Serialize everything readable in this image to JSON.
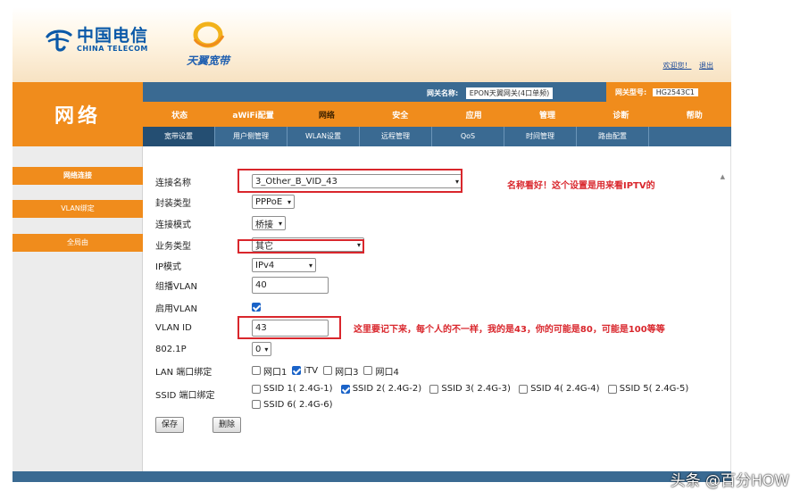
{
  "header": {
    "brand_cn": "中国电信",
    "brand_en": "CHINA TELECOM",
    "sub_brand": "天翼宽带",
    "links": [
      "欢迎您！",
      "退出"
    ]
  },
  "section_title": "网络",
  "info_bar": {
    "gateway_name_label": "网关名称:",
    "gateway_name_value": "EPON天翼网关(4口单频)",
    "gateway_model_label": "网关型号:",
    "gateway_model_value": "HG2543C1"
  },
  "main_nav": [
    "状态",
    "aWiFi配置",
    "网络",
    "安全",
    "应用",
    "管理",
    "诊断",
    "帮助"
  ],
  "sub_nav": [
    "宽带设置",
    "用户侧管理",
    "WLAN设置",
    "远程管理",
    "QoS",
    "时间管理",
    "路由配置"
  ],
  "sidebar": [
    "网络连接",
    "VLAN绑定",
    "全局由"
  ],
  "form": {
    "connection_name": {
      "label": "连接名称",
      "value": "3_Other_B_VID_43"
    },
    "encap_type": {
      "label": "封装类型",
      "value": "PPPoE"
    },
    "conn_mode": {
      "label": "连接模式",
      "value": "桥接"
    },
    "service_type": {
      "label": "业务类型",
      "value": "其它"
    },
    "ip_mode": {
      "label": "IP模式",
      "value": "IPv4"
    },
    "multicast_vlan": {
      "label": "组播VLAN",
      "value": "40"
    },
    "enable_vlan": {
      "label": "启用VLAN",
      "checked": true
    },
    "vlan_id": {
      "label": "VLAN ID",
      "value": "43"
    },
    "dot1p": {
      "label": "802.1P",
      "value": "0"
    },
    "lan_binding": {
      "label": "LAN 端口绑定",
      "options": [
        {
          "name": "网口1",
          "checked": false
        },
        {
          "name": "iTV",
          "checked": true
        },
        {
          "name": "网口3",
          "checked": false
        },
        {
          "name": "网口4",
          "checked": false
        }
      ]
    },
    "ssid_binding": {
      "label": "SSID 端口绑定",
      "options": [
        {
          "name": "SSID 1( 2.4G-1)",
          "checked": false
        },
        {
          "name": "SSID 2( 2.4G-2)",
          "checked": true
        },
        {
          "name": "SSID 3( 2.4G-3)",
          "checked": false
        },
        {
          "name": "SSID 4( 2.4G-4)",
          "checked": false
        },
        {
          "name": "SSID 5( 2.4G-5)",
          "checked": false
        },
        {
          "name": "SSID 6( 2.4G-6)",
          "checked": false
        }
      ]
    },
    "save_label": "保存",
    "delete_label": "删除"
  },
  "annotations": {
    "name_note": "名称看好！这个设置是用来看IPTV的",
    "vlan_note": "这里要记下来，每个人的不一样，我的是43，你的可能是80，可能是100等等"
  },
  "watermark": "头条 @百分HOW",
  "colors": {
    "orange": "#f08c1c",
    "blue_bar": "#3a6a92",
    "red_note": "#d9262c",
    "brand_blue": "#0a59a8"
  }
}
